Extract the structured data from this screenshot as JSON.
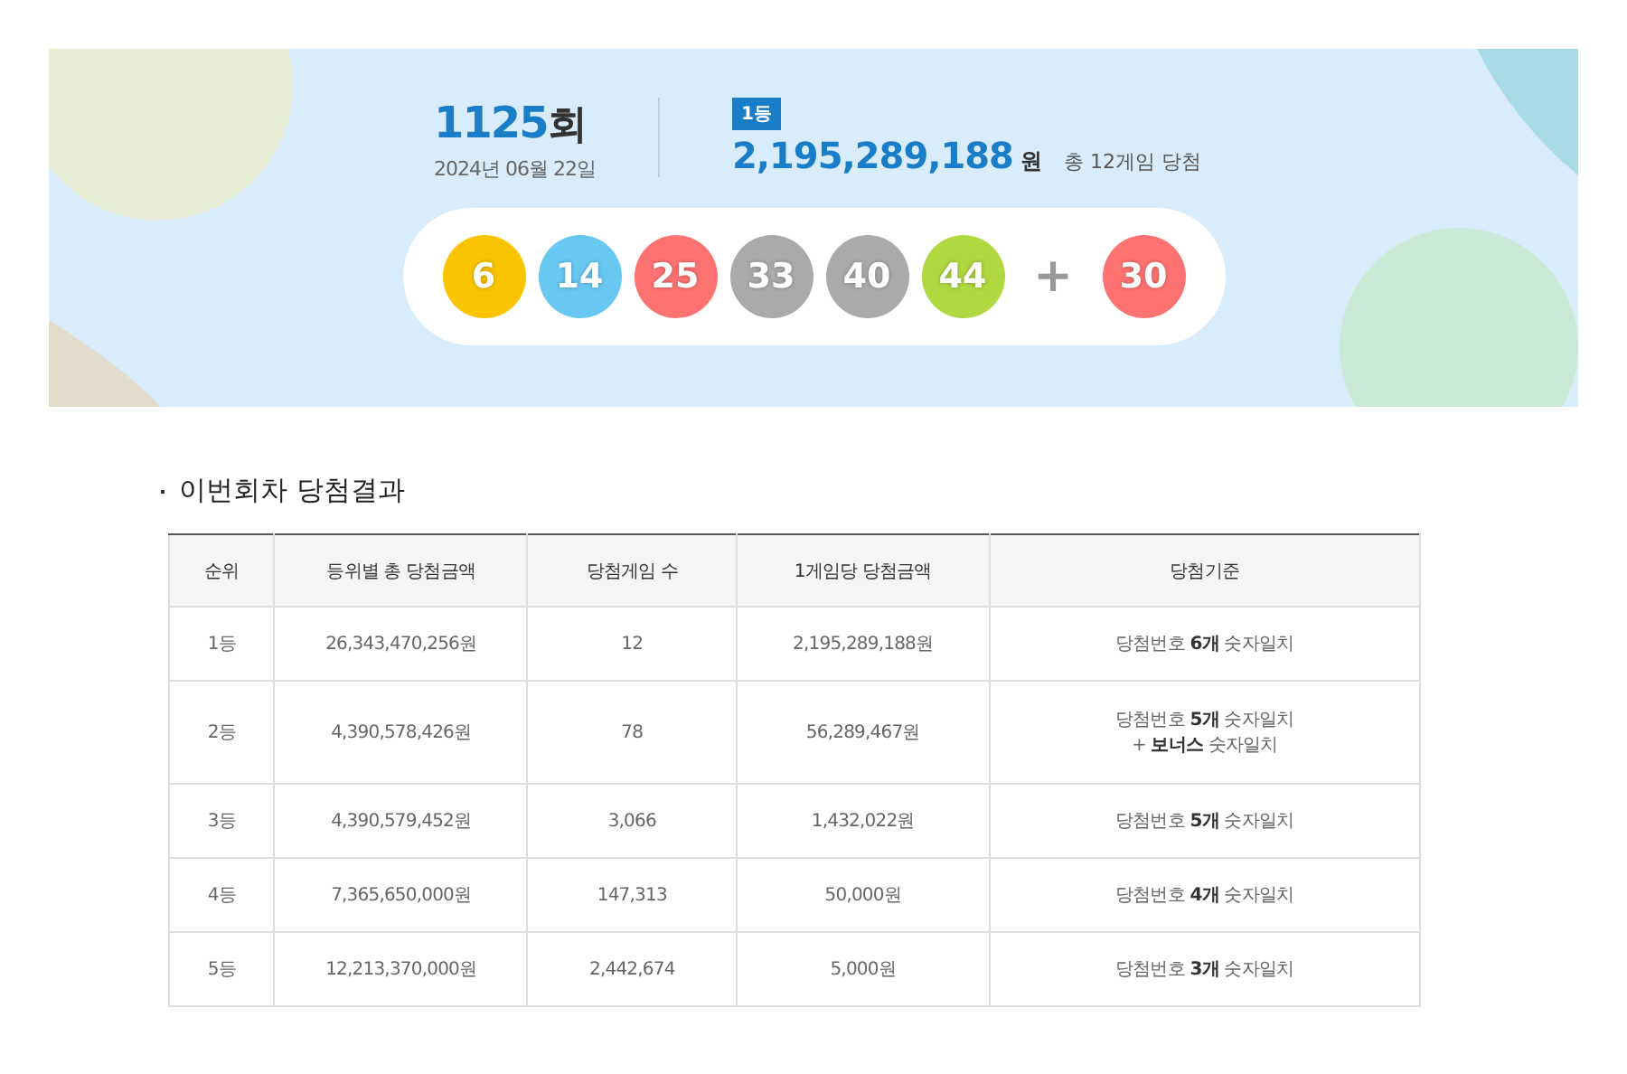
{
  "draw": {
    "round_number": "1125",
    "round_unit": "회",
    "date": "2024년 06월 22일",
    "prize_badge": "1등",
    "prize_amount": "2,195,289,188",
    "prize_unit": "원",
    "winners_note": "총 12게임 당첨",
    "balls": [
      {
        "number": "6",
        "color": "#fbc400"
      },
      {
        "number": "14",
        "color": "#69c8f2"
      },
      {
        "number": "25",
        "color": "#ff7272"
      },
      {
        "number": "33",
        "color": "#aaaaaa"
      },
      {
        "number": "40",
        "color": "#aaaaaa"
      },
      {
        "number": "44",
        "color": "#b0d840"
      }
    ],
    "plus": "+",
    "bonus_ball": {
      "number": "30",
      "color": "#ff7272"
    }
  },
  "results": {
    "title": "이번회차 당첨결과",
    "table": {
      "columns": [
        "순위",
        "등위별 총 당첨금액",
        "당첨게임 수",
        "1게임당 당첨금액",
        "당첨기준"
      ],
      "rows": [
        {
          "rank": "1등",
          "total": "26,343,470,256원",
          "games": "12",
          "per_game": "2,195,289,188원",
          "criteria": [
            "당첨번호 **6개** 숫자일치"
          ]
        },
        {
          "rank": "2등",
          "total": "4,390,578,426원",
          "games": "78",
          "per_game": "56,289,467원",
          "criteria": [
            "당첨번호 **5개** 숫자일치",
            "+ **보너스** 숫자일치"
          ]
        },
        {
          "rank": "3등",
          "total": "4,390,579,452원",
          "games": "3,066",
          "per_game": "1,432,022원",
          "criteria": [
            "당첨번호 **5개** 숫자일치"
          ]
        },
        {
          "rank": "4등",
          "total": "7,365,650,000원",
          "games": "147,313",
          "per_game": "50,000원",
          "criteria": [
            "당첨번호 **4개** 숫자일치"
          ]
        },
        {
          "rank": "5등",
          "total": "12,213,370,000원",
          "games": "2,442,674",
          "per_game": "5,000원",
          "criteria": [
            "당첨번호 **3개** 숫자일치"
          ]
        }
      ]
    }
  }
}
